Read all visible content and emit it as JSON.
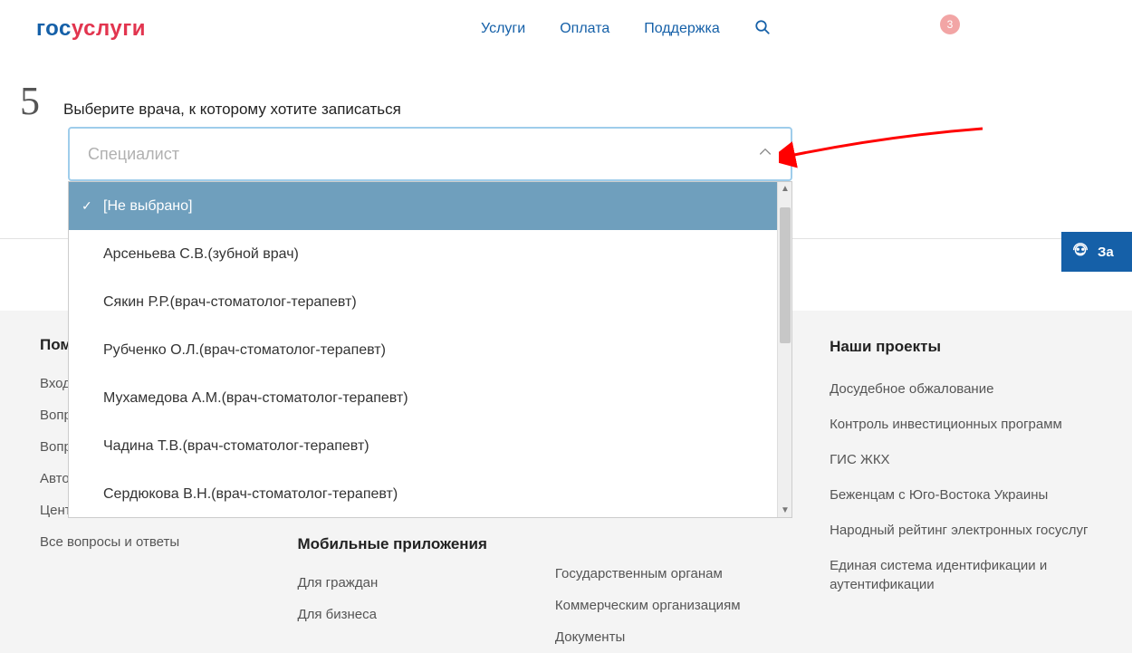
{
  "header": {
    "nav": [
      "Услуги",
      "Оплата",
      "Поддержка"
    ],
    "notif_count": "3"
  },
  "logo": {
    "part1": "гос",
    "part2": "услуги"
  },
  "step": {
    "number": "5",
    "title": "Выберите врача, к которому хотите записаться"
  },
  "dropdown": {
    "placeholder": "Специалист",
    "options": [
      "[Не выбрано]",
      "Арсеньева С.В.(зубной врач)",
      "Сякин Р.Р.(врач-стоматолог-терапевт)",
      "Рубченко О.Л.(врач-стоматолог-терапевт)",
      "Мухамедова А.М.(врач-стоматолог-терапевт)",
      "Чадина Т.В.(врач-стоматолог-терапевт)",
      "Сердюкова В.Н.(врач-стоматолог-терапевт)"
    ]
  },
  "footer": {
    "col1": {
      "heading": "Пом",
      "links": [
        "Вход",
        "Вопр",
        "Вопр",
        "Авто",
        "Цент",
        "Все вопросы и ответы"
      ]
    },
    "col2": {
      "heading": "Мобильные приложения",
      "links": [
        "Для граждан",
        "Для бизнеса"
      ]
    },
    "col3": {
      "links": [
        "Государственным органам",
        "Коммерческим организациям",
        "Документы"
      ]
    },
    "col4": {
      "heading": "Наши проекты",
      "links": [
        "Досудебное обжалование",
        "Контроль инвестиционных программ",
        "ГИС ЖКХ",
        "Беженцам с Юго-Востока Украины",
        "Народный рейтинг электронных госуслуг",
        "Единая система идентификации и аутентификации"
      ]
    }
  },
  "ask_tab_label": "За"
}
